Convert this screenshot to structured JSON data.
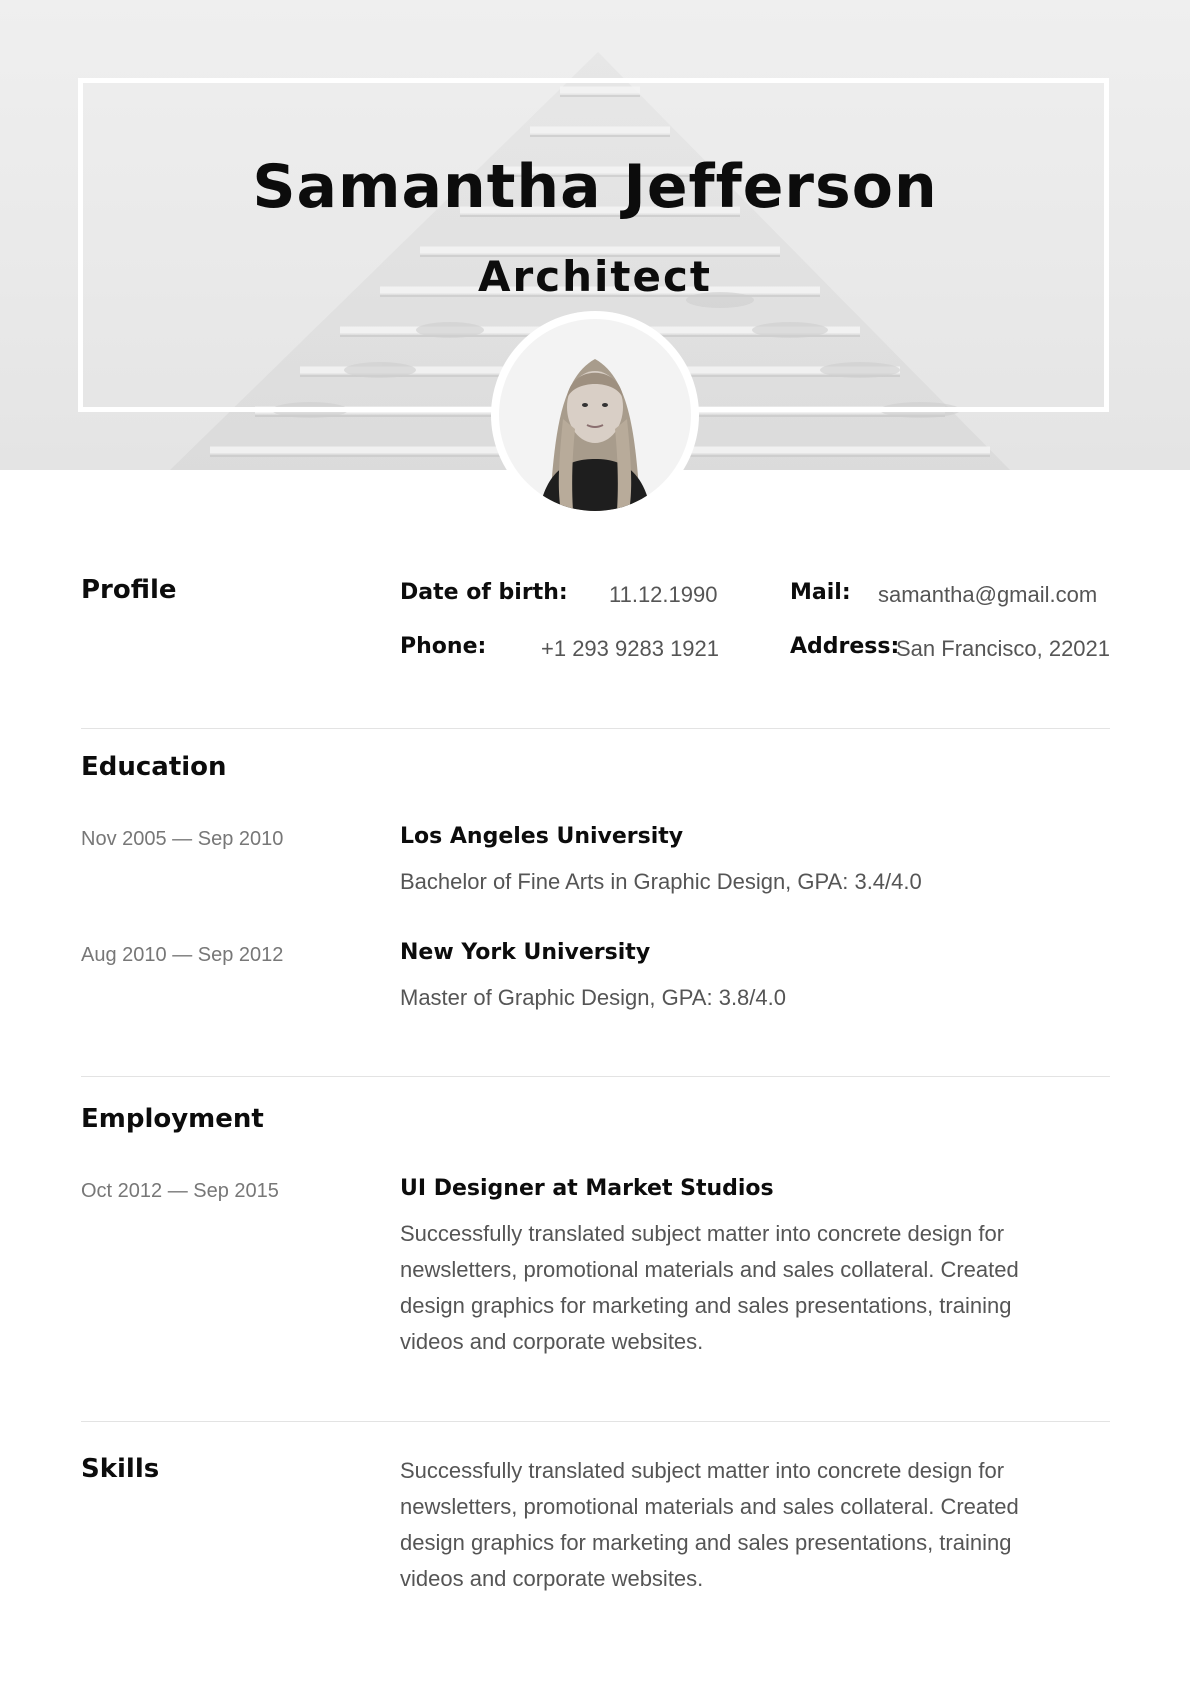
{
  "header": {
    "name": "Samantha Jefferson",
    "role": "Architect"
  },
  "profile": {
    "title": "Profile",
    "dob_label": "Date of birth:",
    "dob_value": "11.12.1990",
    "phone_label": "Phone:",
    "phone_value": "+1 293 9283 1921",
    "mail_label": "Mail:",
    "mail_value": "samantha@gmail.com",
    "address_label": "Address:",
    "address_value": "San Francisco, 22021"
  },
  "education": {
    "title": "Education",
    "items": [
      {
        "dates": "Nov 2005 — Sep 2010",
        "school": "Los Angeles University",
        "detail": "Bachelor of Fine Arts in Graphic Design, GPA: 3.4/4.0"
      },
      {
        "dates": "Aug 2010 — Sep 2012",
        "school": "New York University",
        "detail": "Master of Graphic Design, GPA: 3.8/4.0"
      }
    ]
  },
  "employment": {
    "title": "Employment",
    "items": [
      {
        "dates": "Oct 2012 — Sep 2015",
        "position": "UI Designer at Market Studios",
        "description": "Successfully translated subject matter into concrete design for newsletters, promotional materials and sales collateral. Created design graphics for marketing and sales presentations, training videos and corporate websites."
      }
    ]
  },
  "skills": {
    "title": "Skills",
    "description": "Successfully translated subject matter into concrete design for newsletters, promotional materials and sales collateral. Created design graphics for marketing and sales presentations, training videos and corporate websites."
  },
  "colors": {
    "text_primary": "#0c0c0c",
    "text_secondary": "#555555",
    "text_muted": "#777777",
    "divider": "#e3e3e3",
    "header_bg": "#ececec"
  }
}
